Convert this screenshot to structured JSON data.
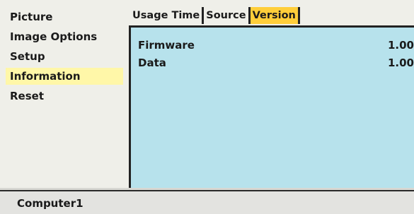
{
  "menu": {
    "items": [
      {
        "label": "Picture"
      },
      {
        "label": "Image Options"
      },
      {
        "label": "Setup"
      },
      {
        "label": "Information",
        "selected": true
      },
      {
        "label": "Reset"
      }
    ]
  },
  "tabs": [
    {
      "label": "Usage Time"
    },
    {
      "label": "Source"
    },
    {
      "label": "Version",
      "active": true
    }
  ],
  "panel": {
    "rows": [
      {
        "label": "Firmware",
        "value": "1.00"
      },
      {
        "label": "Data",
        "value": "1.00"
      }
    ]
  },
  "status": {
    "text": "Computer1"
  },
  "colors": {
    "menu_bg": "#efefe9",
    "menu_selected": "#fff7a8",
    "tab_active": "#ffce3a",
    "panel_bg": "#b7e2ec",
    "status_bg": "#e3e3e0"
  }
}
